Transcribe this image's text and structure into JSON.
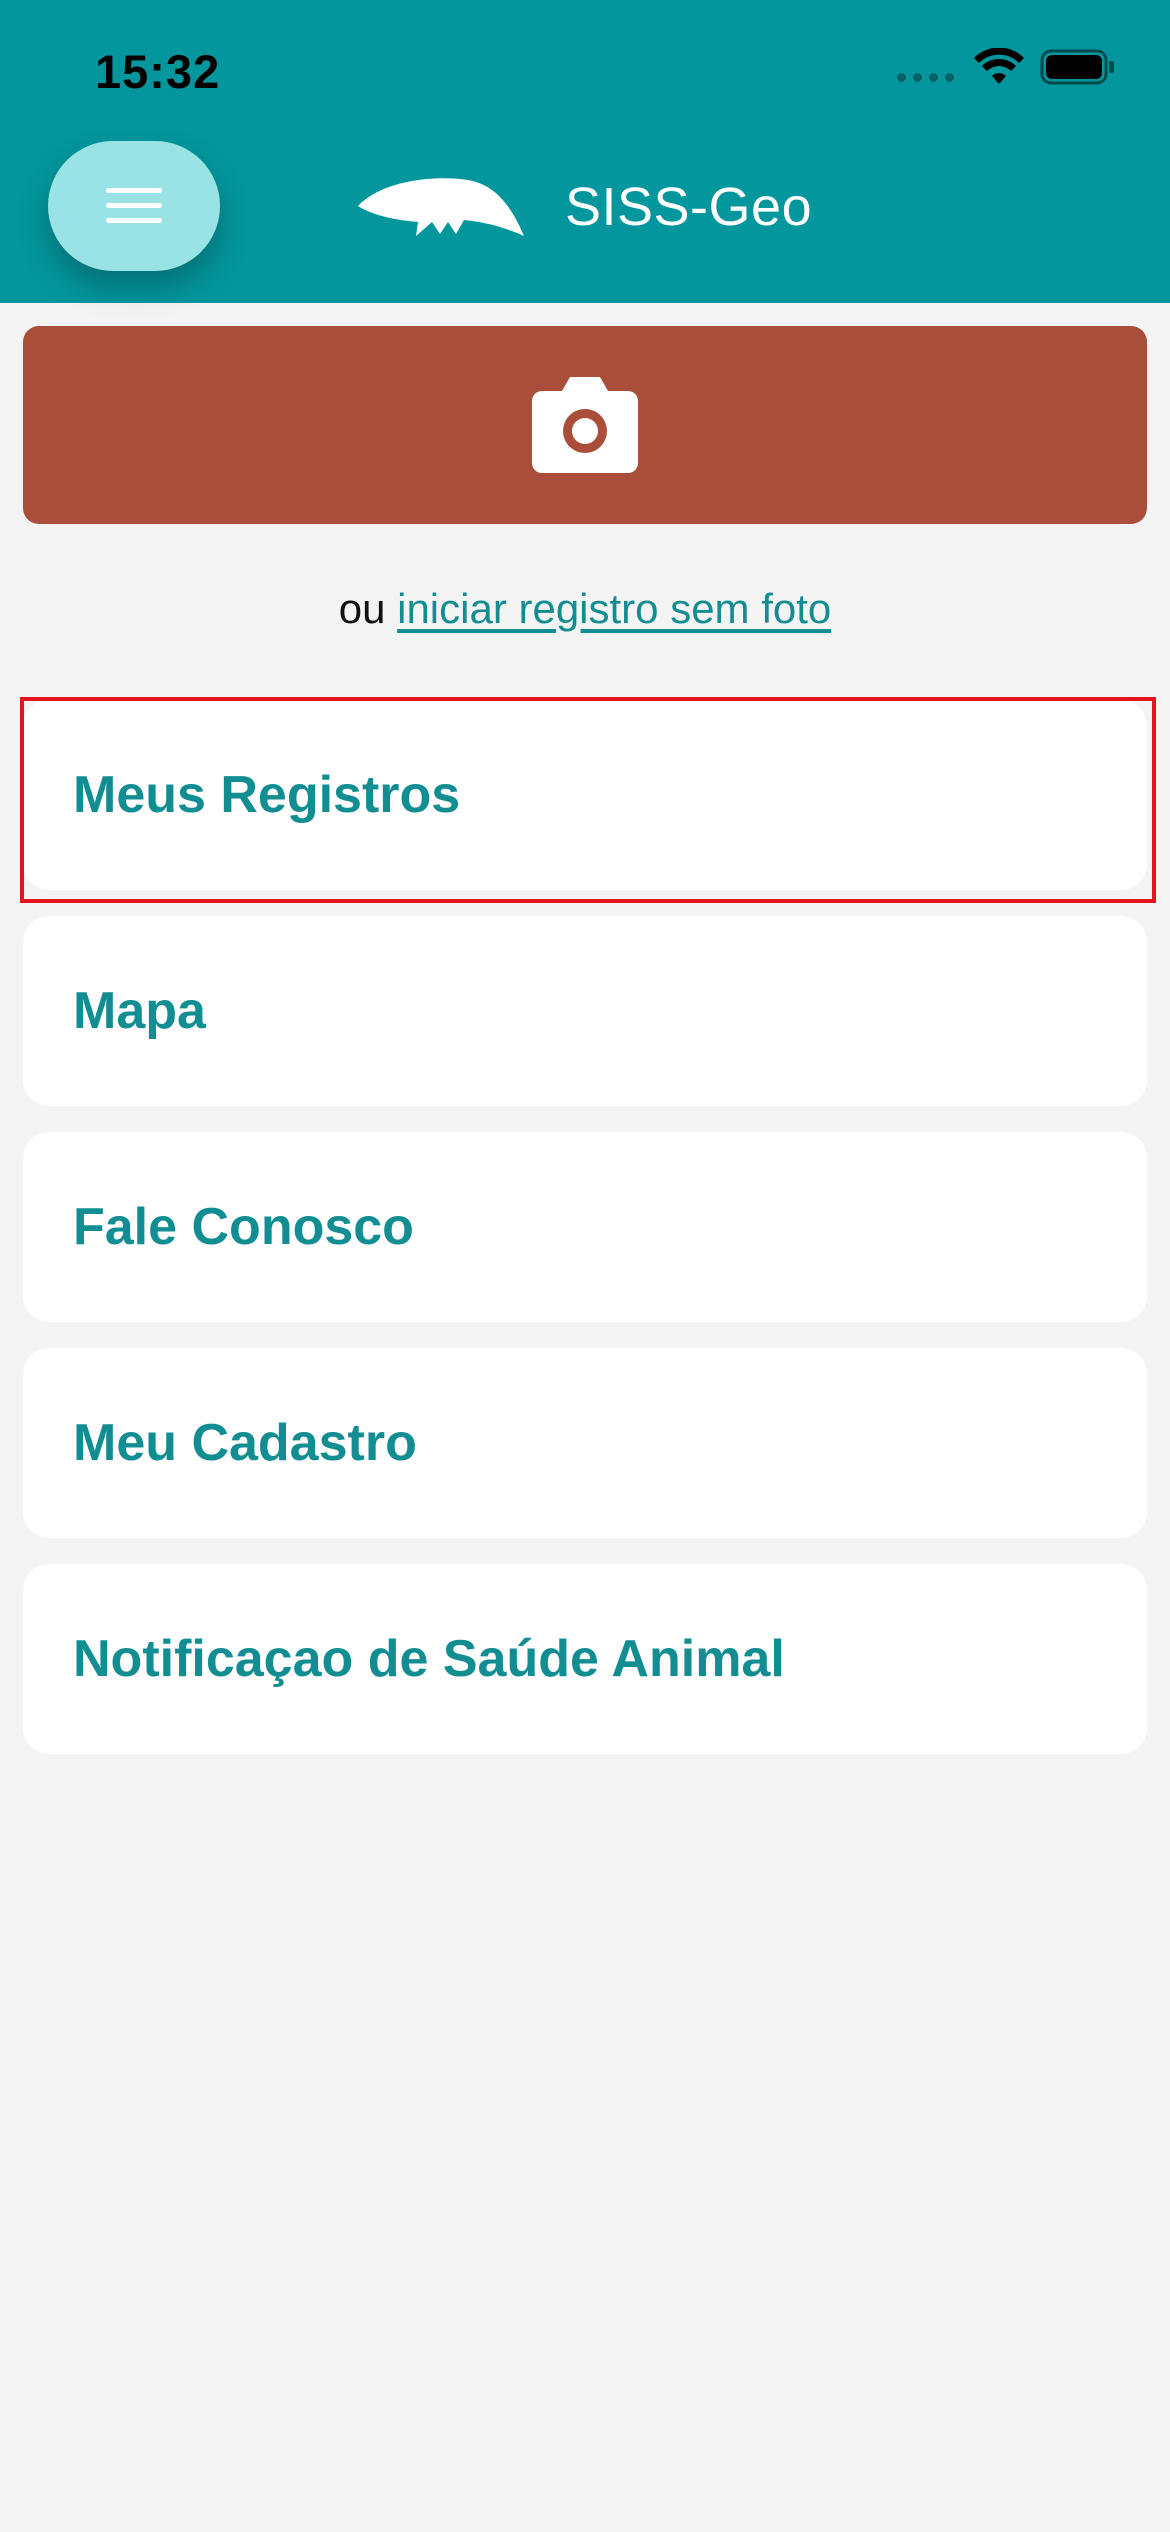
{
  "status_bar": {
    "time": "15:32"
  },
  "header": {
    "title": "SISS-Geo",
    "menu_icon": "hamburger-icon",
    "logo_icon": "anteater-logo-icon"
  },
  "capture": {
    "icon": "camera-icon",
    "prefix": "ou",
    "link_label": "iniciar registro sem foto"
  },
  "menu": {
    "items": [
      {
        "label": "Meus Registros"
      },
      {
        "label": "Mapa"
      },
      {
        "label": "Fale Conosco"
      },
      {
        "label": "Meu Cadastro"
      },
      {
        "label": "Notificaçao de Saúde Animal"
      }
    ]
  },
  "colors": {
    "header_teal": "#03969c",
    "menu_button": "#99e3e4",
    "camera_button": "#a94f39",
    "accent_text": "#128e93",
    "background": "#f4f4f4",
    "highlight": "#e3141c"
  }
}
